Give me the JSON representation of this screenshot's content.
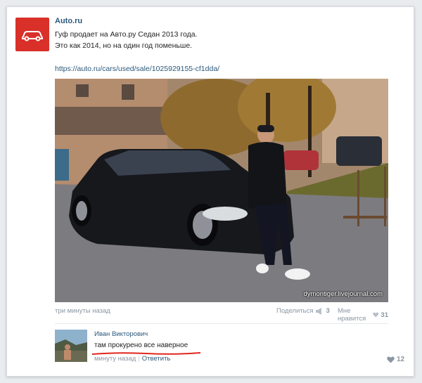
{
  "post": {
    "author": "Auto.ru",
    "text_lines": [
      "Гуф продает на Авто.ру Седан 2013 года.",
      "Это как 2014, но на один год поменьше."
    ],
    "link": "https://auto.ru/cars/used/sale/1025929155-cf1dda/",
    "photo_watermark": "dymontiger.livejournal.com",
    "time": "три минуты назад",
    "share_label": "Поделиться",
    "share_count": "3",
    "like_label": "Мне нравится",
    "like_count": "31"
  },
  "comment": {
    "author": "Иван Викторович",
    "text": "там прокурено все наверное",
    "time": "минуту назад",
    "reply_label": "Ответить",
    "like_count": "12"
  },
  "colors": {
    "brand": "#d9302a",
    "link": "#2b587a",
    "muted": "#8a96a3",
    "annotation": "#e0261c"
  },
  "icons": [
    "car-logo-icon",
    "share-megaphone-icon",
    "heart-icon"
  ]
}
